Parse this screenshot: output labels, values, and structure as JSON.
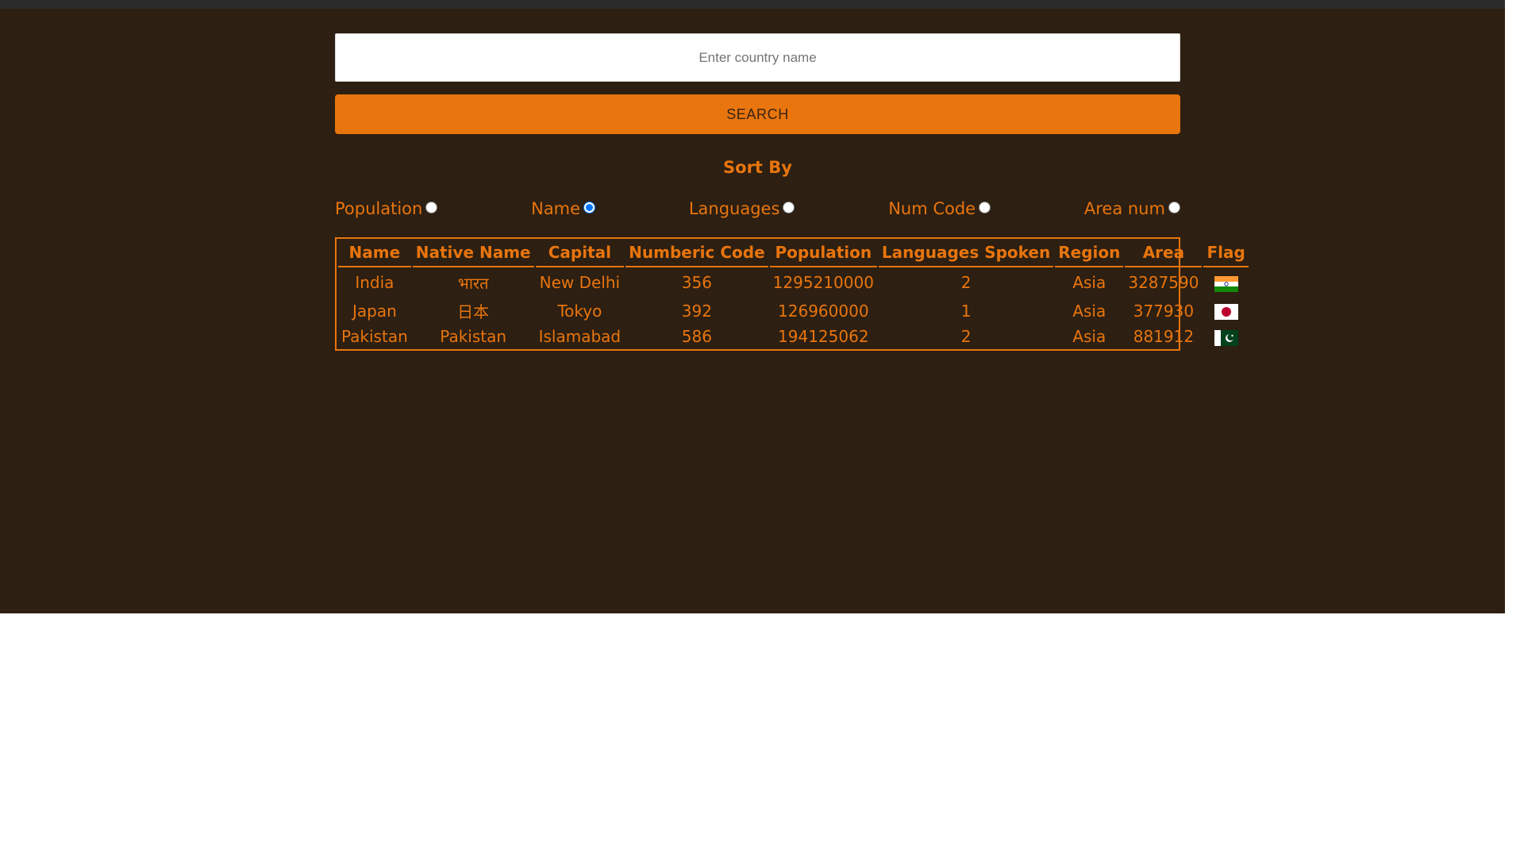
{
  "search": {
    "placeholder": "Enter country name",
    "value": "",
    "button_label": "SEARCH"
  },
  "sort": {
    "title": "Sort By",
    "options": [
      {
        "label": "Population",
        "checked": false
      },
      {
        "label": "Name",
        "checked": true
      },
      {
        "label": "Languages",
        "checked": false
      },
      {
        "label": "Num Code",
        "checked": false
      },
      {
        "label": "Area num",
        "checked": false
      }
    ]
  },
  "table": {
    "headers": [
      "Name",
      "Native Name",
      "Capital",
      "Numberic Code",
      "Population",
      "Languages Spoken",
      "Region",
      "Area",
      "Flag"
    ],
    "rows": [
      {
        "name": "India",
        "native_name": "भारत",
        "capital": "New Delhi",
        "numeric_code": "356",
        "population": "1295210000",
        "languages": "2",
        "region": "Asia",
        "area": "3287590",
        "flag": "india-flag-icon"
      },
      {
        "name": "Japan",
        "native_name": "日本",
        "capital": "Tokyo",
        "numeric_code": "392",
        "population": "126960000",
        "languages": "1",
        "region": "Asia",
        "area": "377930",
        "flag": "japan-flag-icon"
      },
      {
        "name": "Pakistan",
        "native_name": "Pakistan",
        "capital": "Islamabad",
        "numeric_code": "586",
        "population": "194125062",
        "languages": "2",
        "region": "Asia",
        "area": "881912",
        "flag": "pakistan-flag-icon"
      }
    ]
  },
  "colors": {
    "background": "#2d1f11",
    "topbar": "#2b2b2b",
    "accent": "#e8750e",
    "button_text": "#3a2412"
  }
}
